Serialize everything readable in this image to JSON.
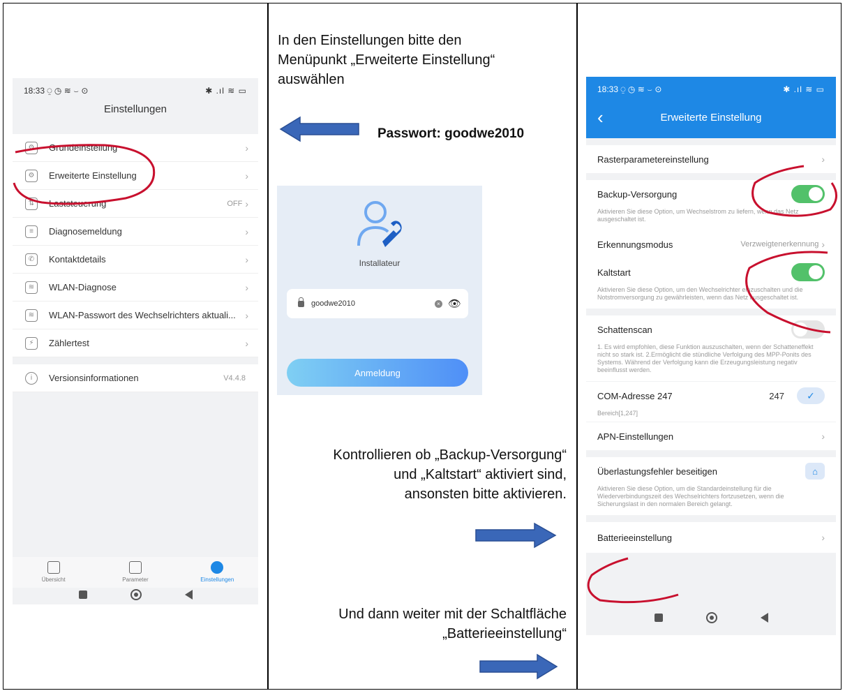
{
  "phone1": {
    "status": {
      "time": "18:33",
      "left_icons": "⍜ ◷ ≋ ⌣ ⊙",
      "right_icons": "✱ .ıl ≋ ▭"
    },
    "title": "Einstellungen",
    "items": [
      {
        "label": "Grundeinstellung",
        "icon": "gear-icon",
        "value": ""
      },
      {
        "label": "Erweiterte Einstellung",
        "icon": "gear-plus-icon",
        "value": ""
      },
      {
        "label": "Laststeuerung",
        "icon": "load-control-icon",
        "value": "OFF"
      },
      {
        "label": "Diagnosemeldung",
        "icon": "diagnosis-icon",
        "value": ""
      },
      {
        "label": "Kontaktdetails",
        "icon": "phone-icon",
        "value": ""
      },
      {
        "label": "WLAN-Diagnose",
        "icon": "wifi-icon",
        "value": ""
      },
      {
        "label": "WLAN-Passwort des Wechselrichters aktuali...",
        "icon": "wifi-lock-icon",
        "value": ""
      },
      {
        "label": "Zählertest",
        "icon": "meter-icon",
        "value": ""
      }
    ],
    "version": {
      "label": "Versionsinformationen",
      "value": "V4.4.8",
      "icon": "info-icon"
    },
    "tabs": [
      {
        "label": "Übersicht",
        "icon": "home-icon"
      },
      {
        "label": "Parameter",
        "icon": "document-icon"
      },
      {
        "label": "Einstellungen",
        "icon": "dots-icon"
      }
    ]
  },
  "instructions": {
    "step1": [
      "In den Einstellungen bitte den",
      "Menüpunkt „Erweiterte Einstellung“",
      "auswählen"
    ],
    "password": "Passwort: goodwe2010",
    "step2": [
      "Kontrollieren ob „Backup-Versorgung“",
      "und „Kaltstart“ aktiviert sind,",
      "ansonsten bitte aktivieren."
    ],
    "step3": [
      "Und dann weiter mit der Schaltfläche",
      "„Batterieeinstellung“"
    ]
  },
  "login": {
    "role": "Installateur",
    "password_value": "goodwe2010",
    "button": "Anmeldung"
  },
  "phone2": {
    "status": {
      "time": "18:33",
      "left_icons": "⍜ ◷ ≋ ⌣ ⊙",
      "right_icons": "✱ .ıl ≋ ▭"
    },
    "title": "Erweiterte Einstellung",
    "raster": "Rasterparametereinstellung",
    "backup": {
      "label": "Backup-Versorgung",
      "desc": "Aktivieren Sie diese Option, um Wechselstrom zu liefern, wenn das Netz ausgeschaltet ist.",
      "enabled": true
    },
    "erkennung": {
      "label": "Erkennungsmodus",
      "value": "Verzweigtenerkennung"
    },
    "kaltstart": {
      "label": "Kaltstart",
      "desc": "Aktivieren Sie diese Option, um den Wechselrichter einzuschalten und die Notstromversorgung zu gewährleisten, wenn das Netz ausgeschaltet ist.",
      "enabled": true
    },
    "schatten": {
      "label": "Schattenscan",
      "desc": "1. Es wird empfohlen, diese Funktion auszuschalten, wenn der Schatteneffekt nicht so stark ist. 2.Ermöglicht die stündliche Verfolgung des MPP-Ponits des Systems. Während der Verfolgung kann die Erzeugungsleistung negativ beeinflusst werden.",
      "enabled": false
    },
    "com": {
      "label": "COM-Adresse  247",
      "range": "Bereich[1,247]",
      "value": "247"
    },
    "apn": "APN-Einstellungen",
    "overload": {
      "label": "Überlastungsfehler beseitigen",
      "desc": "Aktivieren Sie diese Option, um die Standardeinstellung für die Wiederverbindungszeit des Wechselrichters fortzusetzen, wenn die Sicherungslast in den normalen Bereich gelangt."
    },
    "battery": "Batterieeinstellung"
  },
  "colors": {
    "accent": "#1e88e5",
    "toggle_on": "#52c16a",
    "annotation": "#c8102e",
    "arrow": "#3a67b8"
  }
}
